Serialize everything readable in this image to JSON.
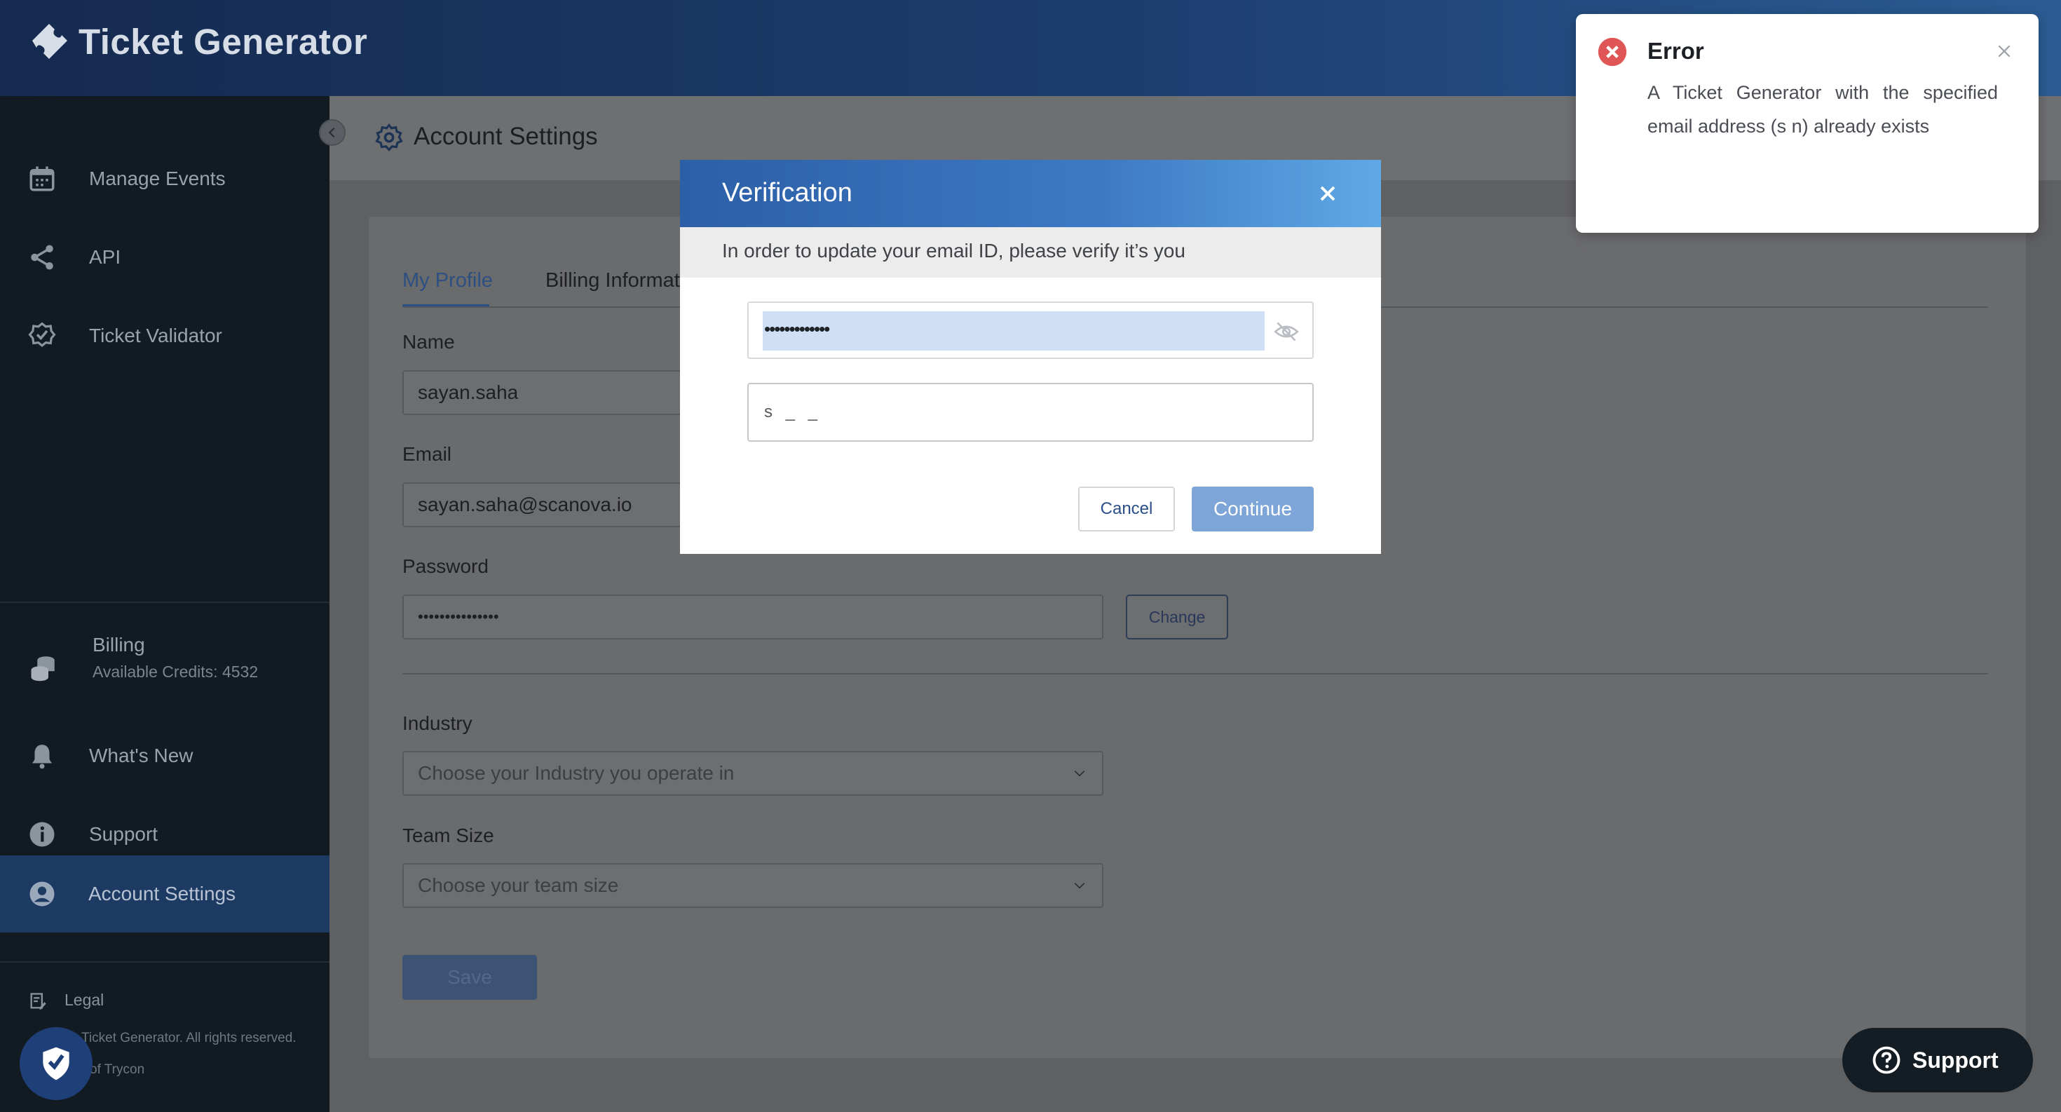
{
  "header": {
    "app_title": "Ticket Generator"
  },
  "sidebar": {
    "items": [
      {
        "label": "Manage Events",
        "icon": "calendar-icon"
      },
      {
        "label": "API",
        "icon": "share-nodes-icon"
      },
      {
        "label": "Ticket Validator",
        "icon": "badge-check-icon"
      }
    ],
    "billing": {
      "label": "Billing",
      "credits": "Available Credits: 4532",
      "icon": "coins-icon"
    },
    "bottom_items": [
      {
        "label": "What's New",
        "icon": "bell-icon"
      },
      {
        "label": "Support",
        "icon": "info-icon"
      },
      {
        "label": "Account Settings",
        "icon": "user-circle-icon",
        "active": true
      }
    ],
    "legal": "Legal",
    "copyright": "Ticket Generator. All rights reserved.",
    "trycon": "of Trycon"
  },
  "page": {
    "title": "Account Settings",
    "tabs": [
      {
        "label": "My Profile",
        "active": true
      },
      {
        "label": "Billing Informat"
      }
    ],
    "form": {
      "name_label": "Name",
      "name_value": "sayan.saha",
      "email_label": "Email",
      "email_value": "sayan.saha@scanova.io",
      "password_label": "Password",
      "password_value": "•••••••••••••••",
      "change_label": "Change",
      "industry_label": "Industry",
      "industry_placeholder": "Choose your Industry you operate in",
      "team_label": "Team Size",
      "team_placeholder": "Choose your team size",
      "save_label": "Save"
    }
  },
  "modal": {
    "title": "Verification",
    "subtitle": "In order to update your email ID, please verify it’s you",
    "password_value": "•••••••••••••",
    "email_value_obscured": "s          _ _",
    "cancel_label": "Cancel",
    "continue_label": "Continue"
  },
  "toast": {
    "title": "Error",
    "message": "A Ticket Generator with the specified email address (s                       n) already exists"
  },
  "support_fab": {
    "label": "Support"
  },
  "colors": {
    "header_dark": "#152a4f",
    "sidebar": "#121a22",
    "active_item": "#1d3a63",
    "modal_header": "#2c5fa7",
    "continue": "#7ea5d8",
    "error": "#e05555"
  }
}
